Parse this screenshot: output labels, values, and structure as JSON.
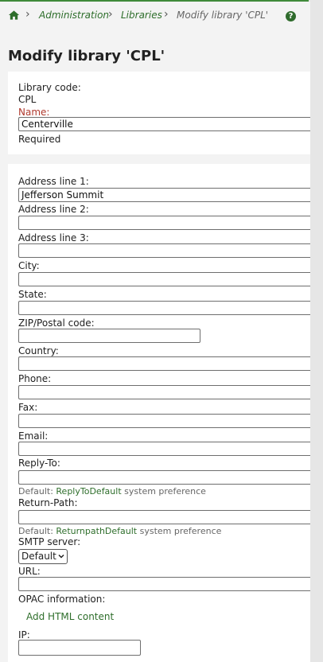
{
  "breadcrumb": {
    "home_icon": "home-icon",
    "items": [
      "Administration",
      "Libraries",
      "Modify library 'CPL'"
    ]
  },
  "help_icon": "?",
  "page_title": "Modify library 'CPL'",
  "library": {
    "code_label": "Library code:",
    "code_value": "CPL",
    "name_label": "Name:",
    "name_value": "Centerville",
    "required_text": "Required"
  },
  "address": {
    "line1_label": "Address line 1:",
    "line1_value": "Jefferson Summit",
    "line2_label": "Address line 2:",
    "line2_value": "",
    "line3_label": "Address line 3:",
    "line3_value": "",
    "city_label": "City:",
    "city_value": "",
    "state_label": "State:",
    "state_value": "",
    "zip_label": "ZIP/Postal code:",
    "zip_value": "",
    "country_label": "Country:",
    "country_value": "",
    "phone_label": "Phone:",
    "phone_value": "",
    "fax_label": "Fax:",
    "fax_value": "",
    "email_label": "Email:",
    "email_value": "",
    "replyto_label": "Reply-To:",
    "replyto_value": "",
    "replyto_hint_prefix": "Default:",
    "replyto_hint_link": "ReplyToDefault",
    "replyto_hint_suffix": "system preference",
    "returnpath_label": "Return-Path:",
    "returnpath_value": "",
    "returnpath_hint_prefix": "Default:",
    "returnpath_hint_link": "ReturnpathDefault",
    "returnpath_hint_suffix": "system preference",
    "smtp_label": "SMTP server:",
    "smtp_value": "Default",
    "url_label": "URL:",
    "url_value": "",
    "opac_label": "OPAC information:",
    "opac_link": "Add HTML content",
    "ip_label": "IP:",
    "ip_value": ""
  },
  "colors": {
    "link_green": "#2e6e2b",
    "required_red": "#b03a2e",
    "accent_bar": "#3f8a3a"
  }
}
